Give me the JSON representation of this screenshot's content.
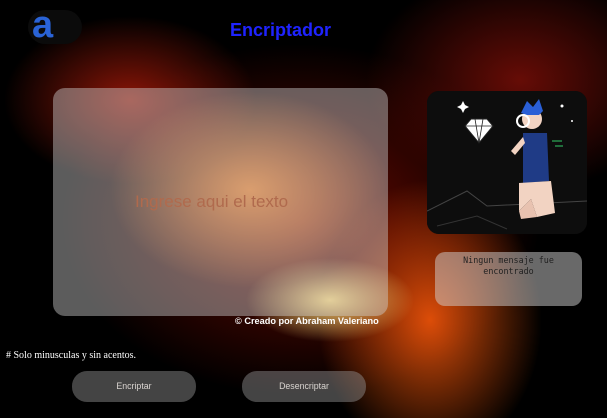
{
  "header": {
    "logo_letter": "a",
    "title": "Encriptador"
  },
  "input": {
    "placeholder": "Ingrese aqui el texto"
  },
  "output": {
    "message": "Ningun mensaje fue encontrado",
    "illustration_icon": "person-with-magnifier-and-diamond"
  },
  "footer": {
    "credit": "© Creado por Abraham Valeriano",
    "note": "# Solo minusculas y sin acentos."
  },
  "buttons": {
    "encrypt": "Encriptar",
    "decrypt": "Desencriptar"
  },
  "colors": {
    "title": "#1f23ff",
    "logo": "#2a63d6",
    "background": "#000000"
  }
}
